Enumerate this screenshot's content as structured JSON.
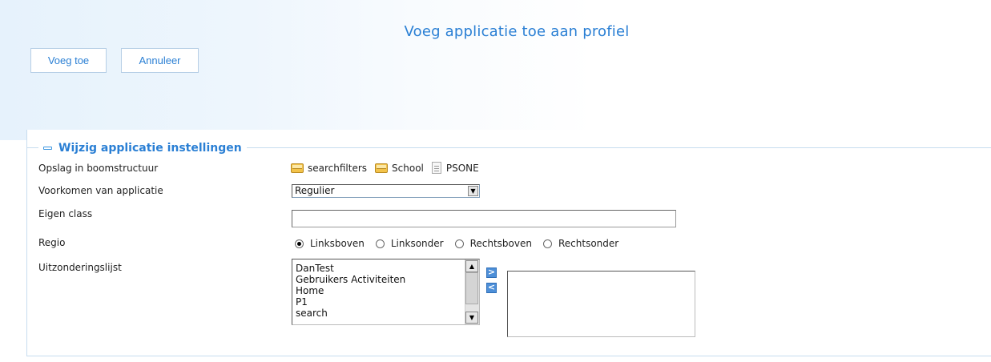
{
  "page": {
    "title": "Voeg applicatie toe aan profiel"
  },
  "toolbar": {
    "add_label": "Voeg toe",
    "cancel_label": "Annuleer"
  },
  "section": {
    "title": "Wijzig applicatie instellingen",
    "fields": {
      "storage": {
        "label": "Opslag in boomstructuur",
        "path": [
          {
            "name": "searchfilters",
            "icon": "folder-icon"
          },
          {
            "name": "School",
            "icon": "folder-icon"
          },
          {
            "name": "PSONE",
            "icon": "document-icon"
          }
        ]
      },
      "appearance": {
        "label": "Voorkomen van applicatie",
        "selected": "Regulier"
      },
      "custom_class": {
        "label": "Eigen class",
        "value": ""
      },
      "region": {
        "label": "Regio",
        "options": [
          "Linksboven",
          "Linksonder",
          "Rechtsboven",
          "Rechtsonder"
        ],
        "selected": "Linksboven"
      },
      "exceptions": {
        "label": "Uitzonderingslijst",
        "available": [
          "DanTest",
          "Gebruikers Activiteiten",
          "Home",
          "P1",
          "search"
        ],
        "selected": [],
        "move_right_symbol": ">",
        "move_left_symbol": "<"
      }
    }
  },
  "colors": {
    "accent": "#2a7fd4",
    "border": "#c7dcef",
    "button_blue": "#4d8fd8"
  }
}
